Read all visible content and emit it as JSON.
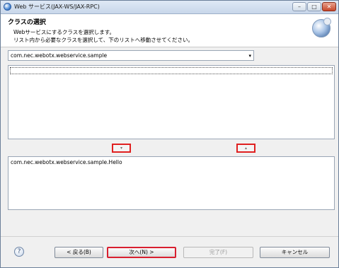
{
  "window": {
    "title": "Web サービス(JAX-WS/JAX-RPC)",
    "min_glyph": "–",
    "max_glyph": "□",
    "close_glyph": "✕"
  },
  "header": {
    "title": "クラスの選択",
    "desc_line1": "Webサービスにするクラスを選択します。",
    "desc_line2": "リスト内から必要なクラスを選択して、下のリストへ移動させてください。"
  },
  "package_combo": {
    "value": "com.nec.webotx.webservice.sample",
    "arrow_glyph": "▾"
  },
  "available_classes": [],
  "move_buttons": {
    "down_glyph": "▾",
    "up_glyph": "▴"
  },
  "selected_classes": [
    "com.nec.webotx.webservice.sample.Hello"
  ],
  "footer": {
    "help_glyph": "?",
    "back_label": "< 戻る(B)",
    "next_label": "次へ(N) >",
    "finish_label": "完了(F)",
    "cancel_label": "キャンセル"
  },
  "colors": {
    "highlight": "#e02020",
    "title_gradient_top": "#dfe9f5",
    "title_gradient_bottom": "#c8d7ea"
  }
}
